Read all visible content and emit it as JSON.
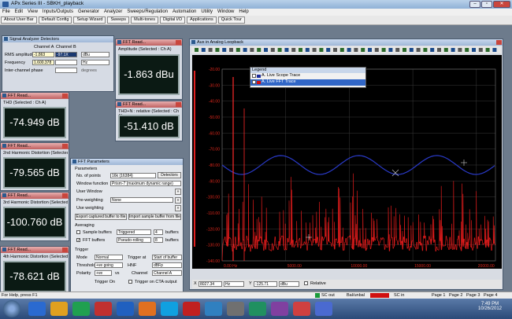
{
  "app": {
    "title": "APx Series III - SBKH_playback"
  },
  "menu": [
    "File",
    "Edit",
    "View",
    "Inputs/Outputs",
    "Generator",
    "Analyzer",
    "Sweeps/Regulation",
    "Automation",
    "Utility",
    "Window",
    "Help"
  ],
  "toolbar": [
    "About User Bar",
    "Default Config",
    "Setup Wizard",
    "Sweeps",
    "Multi-tones",
    "Digital I/O",
    "Applications",
    "Quick Tour"
  ],
  "sad": {
    "title": "Signal Analyzer Detectors",
    "chA": "Channel A",
    "chB": "Channel B",
    "rms_label": "RMS amplitude",
    "rms_a": "-1.863",
    "rms_b": "-97.1X",
    "rms_unit": "dBu",
    "freq_label": "Frequency",
    "freq_a": "1.600.378",
    "freq_unit": "Hz",
    "phase_label": "Inter-channel phase",
    "phase_unit": "degrees"
  },
  "amp": {
    "title": "FFT Read...",
    "sub": "Amplitude (Selected : Ch A)",
    "value": "-1.863 dBu"
  },
  "thdn": {
    "title": "FFT Read...",
    "sub": "THD+N : relative (Selected : Ch A)",
    "value": "-51.410 dB"
  },
  "thd": {
    "title": "FFT Read...",
    "sub": "THD (Selected : Ch A)",
    "value": "-74.949 dB"
  },
  "h2": {
    "title": "FFT Read...",
    "sub": "2nd Harmonic Distortion (Selected : Ch",
    "value": "-79.565 dB"
  },
  "h3": {
    "title": "FFT Read...",
    "sub": "3rd Harmonic Distortion (Selected : Ch",
    "value": "-100.760 dB"
  },
  "h4": {
    "title": "FFT Read...",
    "sub": "4th Harmonic Distortion (Selected : Ch",
    "value": "-78.621 dB"
  },
  "fftp": {
    "title": "FFT Parameters",
    "params": "Parameters",
    "npts_label": "No. of points",
    "npts": "16k (16384)",
    "detectors": "Detectors",
    "win_label": "Window function",
    "win": "Prism-7 (maximum dynamic range)",
    "userwin": "User Window",
    "preweight_label": "Pre-weighting",
    "preweight": "None",
    "useweight": "Use weighting",
    "export": "Export captured buffer to file",
    "import": "Import sample buffer from file",
    "averaging": "Averaging",
    "sample_buffers": "Sample buffers",
    "triggered": "Triggered",
    "avg_n1": "4",
    "buffers": "buffers",
    "fft_buffers": "FFT buffers",
    "pseudo": "Pseudo-rolling",
    "avg_n2": "8",
    "trigger": "Trigger",
    "mode_label": "Mode",
    "mode": "Normal",
    "trig_at": "Trigger at",
    "trig_at_val": "Start of buffer",
    "thr_label": "Threshold",
    "thr": "+ve going",
    "hnf": "HNF",
    "hnf_val": "dBFp",
    "pol_label": "Polarity",
    "pol": "+ve",
    "vs": "vs",
    "channel_label": "Channel",
    "channel": "Channel A",
    "trig_on": "Trigger On",
    "trig_cta": "Trigger on CTA output"
  },
  "scope": {
    "title": "Aux in Analog Loopback",
    "legend_title": "Legend",
    "legend": [
      "A. Live Scope Trace",
      "A. Live FFT Trace"
    ],
    "yticks": [
      "-20.00",
      "-30.00",
      "-40.00",
      "-50.00",
      "-60.00",
      "-70.00",
      "-80.00",
      "-90.00",
      "-100.00",
      "-110.00",
      "-120.00",
      "-130.00",
      "-140.00"
    ],
    "xticks": [
      "0.00 Hz",
      "5000.00",
      "10000.00",
      "15000.00",
      "20000.00"
    ],
    "x_label": "X",
    "x_val": "8027.34",
    "x_unit": "Hz",
    "y_label": "Y",
    "y_val": "-125.71",
    "y_unit": "dBu",
    "relative": "Relative"
  },
  "statusbar": {
    "help": "For Help, press F1",
    "pages": [
      "Page 1",
      "Page 2",
      "Page 3",
      "Page 4"
    ],
    "sc_out": "SC out",
    "bailunbal": "Bal/unbal",
    "sc_in": "SC in"
  },
  "clock": {
    "time": "7:49 PM",
    "date": "10/26/2012"
  },
  "taskbar_icons": [
    "windows-orb",
    "ie-icon",
    "explorer-icon",
    "media-icon",
    "word-icon",
    "outlook-icon",
    "firefox-icon",
    "skype-icon",
    "acrobat-icon",
    "paint-icon",
    "app1-icon",
    "app2-icon",
    "app3-icon",
    "app4-icon",
    "app5-icon"
  ]
}
